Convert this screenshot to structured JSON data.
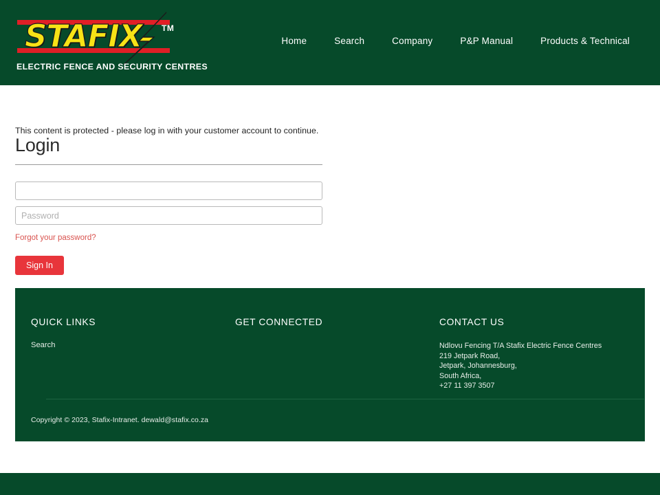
{
  "header": {
    "background_color": "#064A2A",
    "logo": {
      "wordmark": "STAFIX",
      "trademark": "TM",
      "tagline": "ELECTRIC FENCE AND SECURITY CENTRES",
      "wordmark_color": "#F7E316",
      "bar_color": "#E01F26",
      "bolt_color": "#F7E316",
      "bolt_icon": "lightning-bolt-icon"
    },
    "nav": [
      {
        "label": "Home"
      },
      {
        "label": "Search"
      },
      {
        "label": "Company"
      },
      {
        "label": "P&P Manual"
      },
      {
        "label": "Products & Technical"
      }
    ]
  },
  "main": {
    "protected_message": "This content is protected - please log in with your customer account to continue.",
    "title": "Login",
    "form": {
      "username": {
        "value": "",
        "placeholder": ""
      },
      "password": {
        "value": "",
        "placeholder": "Password"
      },
      "forgot_label": "Forgot your password?",
      "submit_label": "Sign In",
      "submit_color": "#E8353B",
      "link_color": "#D9534F"
    }
  },
  "footer": {
    "background_color": "#064A2A",
    "quick_links": {
      "heading": "QUICK LINKS",
      "items": [
        {
          "label": "Search"
        }
      ]
    },
    "get_connected": {
      "heading": "GET CONNECTED"
    },
    "contact": {
      "heading": "CONTACT US",
      "lines": [
        "Ndlovu Fencing T/A Stafix Electric Fence Centres",
        "219 Jetpark Road,",
        "Jetpark, Johannesburg,",
        "South Africa,",
        "+27 11 397 3507"
      ]
    },
    "copyright": "Copyright © 2023, Stafix-Intranet. dewald@stafix.co.za"
  }
}
